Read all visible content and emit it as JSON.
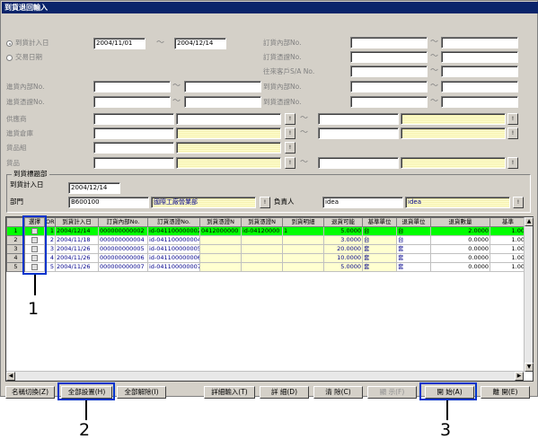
{
  "window": {
    "title": "到貨退回輸入"
  },
  "filters": {
    "radio_arrival_date": "到貨計入日",
    "radio_trade_date": "交易日期",
    "date_from": "2004/11/01",
    "date_to": "2004/12/14",
    "order_internal_no": "訂貨內部No.",
    "order_voucher_no": "訂貨憑證No.",
    "customer_sa_no": "往來客戶S/A No.",
    "purchase_internal_no": "進貨內部No.",
    "arrival_internal_no": "到貨內部No.",
    "purchase_voucher_no": "進貨憑證No.",
    "arrival_voucher_no": "到貨憑證No.",
    "supplier": "供應商",
    "warehouse": "進貨倉庫",
    "item_group": "貨品組",
    "item": "貨品",
    "tilde": "～",
    "search_btn": "!"
  },
  "arrival_dept": {
    "group_title": "到貨標題部",
    "arrival_date_label": "到貨計入日",
    "arrival_date": "2004/12/14",
    "dept_label": "部門",
    "dept_code": "B600100",
    "dept_name": "國際工廠營業部",
    "manager_label": "負責人",
    "manager_code": "idea",
    "manager_name": "idea"
  },
  "grid": {
    "headers": [
      "選擇",
      "OR",
      "到貨計入日",
      "訂貨內部No.",
      "訂貨憑證No.",
      "到貨憑證N",
      "到貨憑證N",
      "到貨明細",
      "退貨可能",
      "基準單位",
      "退貨單位",
      "退貨數量",
      "基準"
    ],
    "rows": [
      {
        "n": "1",
        "or": "1",
        "date": "2004/12/14",
        "int_no": "000000000002",
        "voucher": "id-041100000002",
        "a1": "0412000000",
        "a2": "id-04120000",
        "detail": "1",
        "qty": "5.0000",
        "base_unit": "台",
        "ret_unit": "台",
        "ret_qty": "2.0000",
        "base": "1.00"
      },
      {
        "n": "2",
        "or": "2",
        "date": "2004/11/18",
        "int_no": "000000000004",
        "voucher": "id-041100000004",
        "a1": "",
        "a2": "",
        "detail": "",
        "qty": "3.0000",
        "base_unit": "台",
        "ret_unit": "台",
        "ret_qty": "0.0000",
        "base": "1.00"
      },
      {
        "n": "3",
        "or": "3",
        "date": "2004/11/26",
        "int_no": "000000000005",
        "voucher": "id-041100000005",
        "a1": "",
        "a2": "",
        "detail": "",
        "qty": "20.0000",
        "base_unit": "套",
        "ret_unit": "套",
        "ret_qty": "0.0000",
        "base": "1.00"
      },
      {
        "n": "4",
        "or": "4",
        "date": "2004/11/26",
        "int_no": "000000000006",
        "voucher": "id-041100000006",
        "a1": "",
        "a2": "",
        "detail": "",
        "qty": "10.0000",
        "base_unit": "套",
        "ret_unit": "套",
        "ret_qty": "0.0000",
        "base": "1.00"
      },
      {
        "n": "5",
        "or": "5",
        "date": "2004/11/26",
        "int_no": "000000000007",
        "voucher": "id-041100000007",
        "a1": "",
        "a2": "",
        "detail": "",
        "qty": "5.0000",
        "base_unit": "套",
        "ret_unit": "套",
        "ret_qty": "0.0000",
        "base": "1.00"
      }
    ]
  },
  "buttons": {
    "name_switch": "名稱切換(Z)",
    "select_all": "全部設置(H)",
    "deselect_all": "全部解除(I)",
    "detail_input": "詳細輸入(T)",
    "detail": "詳 細(D)",
    "clear": "清 除(C)",
    "display": "顯 示(F)",
    "close_batch": "開 始(A)",
    "exit": "離 開(E)"
  },
  "annotations": {
    "one": "1",
    "two": "2",
    "three": "3"
  }
}
